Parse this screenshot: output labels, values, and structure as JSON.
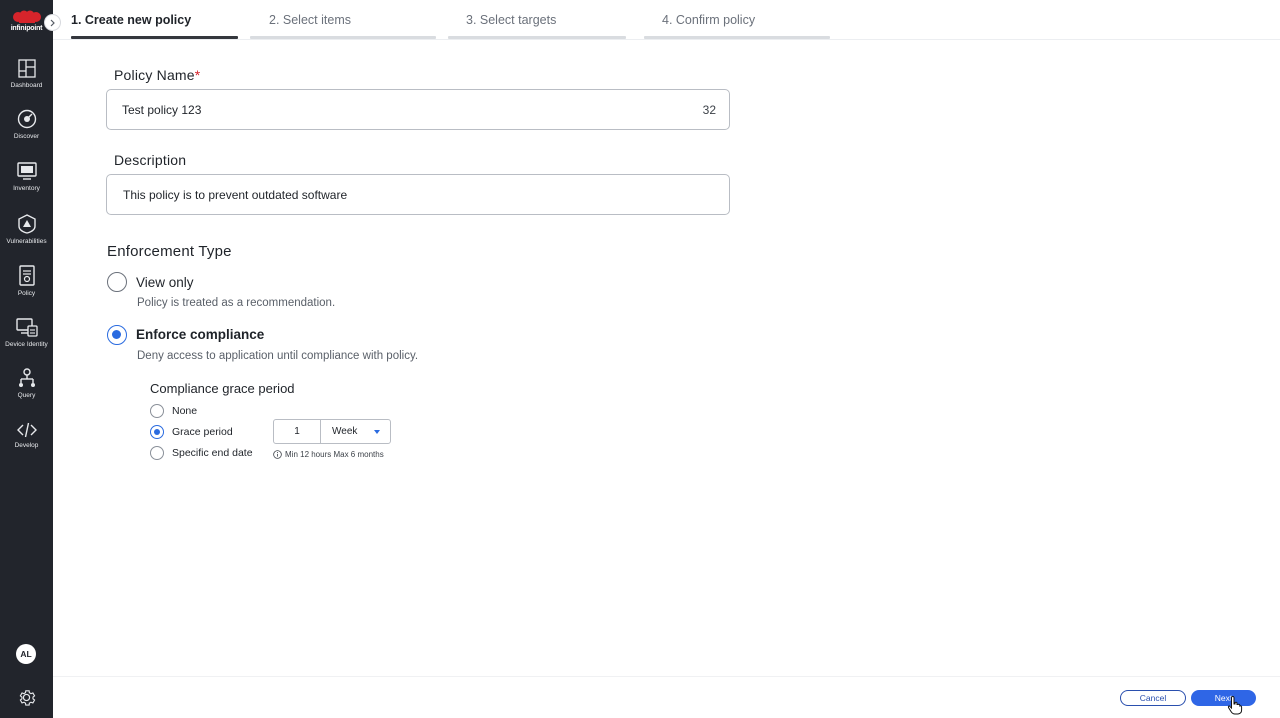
{
  "brand": {
    "name": "infinipoint",
    "color": "#d6242b"
  },
  "sidebar": {
    "items": [
      {
        "label": "Dashboard",
        "icon": "dashboard-icon"
      },
      {
        "label": "Discover",
        "icon": "discover-icon"
      },
      {
        "label": "Inventory",
        "icon": "inventory-icon"
      },
      {
        "label": "Vulnerabilities",
        "icon": "warning-shield-icon"
      },
      {
        "label": "Policy",
        "icon": "policy-document-icon"
      },
      {
        "label": "Device Identity",
        "icon": "device-identity-icon"
      },
      {
        "label": "Query",
        "icon": "query-hierarchy-icon"
      },
      {
        "label": "Develop",
        "icon": "code-icon"
      }
    ],
    "avatar_initials": "AL"
  },
  "steps": [
    {
      "label": "1. Create new policy",
      "active": true
    },
    {
      "label": "2. Select items",
      "active": false
    },
    {
      "label": "3. Select targets",
      "active": false
    },
    {
      "label": "4. Confirm policy",
      "active": false
    }
  ],
  "form": {
    "policy_name": {
      "label": "Policy Name",
      "required_mark": "*",
      "value": "Test policy 123",
      "counter": "32"
    },
    "description": {
      "label": "Description",
      "value": "This policy is to prevent outdated software"
    },
    "enforcement": {
      "title": "Enforcement Type",
      "options": [
        {
          "title": "View only",
          "desc": "Policy is treated as a recommendation.",
          "selected": false
        },
        {
          "title": "Enforce compliance",
          "desc": "Deny access to application until compliance with policy.",
          "selected": true
        }
      ]
    },
    "grace": {
      "title": "Compliance grace period",
      "options": [
        {
          "label": "None",
          "selected": false
        },
        {
          "label": "Grace period",
          "selected": true
        },
        {
          "label": "Specific end date",
          "selected": false
        }
      ],
      "amount": "1",
      "unit": "Week",
      "hint": "Min 12 hours Max 6 months"
    }
  },
  "footer": {
    "cancel_label": "Cancel",
    "next_label": "Next"
  },
  "colors": {
    "primary": "#2f66e6",
    "sidebar": "#22252c",
    "required": "#d6242b"
  }
}
